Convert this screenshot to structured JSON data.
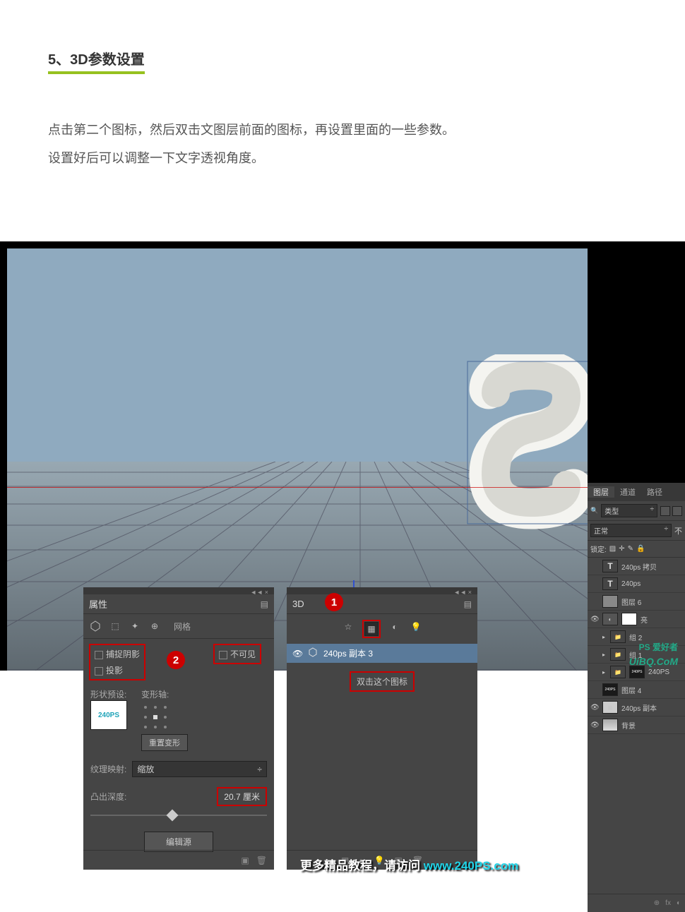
{
  "section": {
    "number": "5、",
    "title": "3D参数设置"
  },
  "body": {
    "line1": "点击第二个图标，然后双击文图层前面的图标，再设置里面的一些参数。",
    "line2": "设置好后可以调整一下文字透视角度。"
  },
  "properties_panel": {
    "title": "属性",
    "mesh_tab": "网格",
    "capture_shadow": "捕捉阴影",
    "cast_shadow": "投影",
    "invisible": "不可见",
    "shape_preset": "形状预设:",
    "preset_thumb_text": "240PS",
    "deform_axis": "变形轴:",
    "reset_deform": "重置变形",
    "texture_mapping": "纹理映射:",
    "texture_value": "缩放",
    "extrude_depth": "凸出深度:",
    "extrude_value": "20.7 厘米",
    "edit_source": "编辑源",
    "badge_2": "2"
  },
  "threed_panel": {
    "title": "3D",
    "badge_1": "1",
    "layer_name": "240ps 副本 3",
    "tip": "双击这个图标"
  },
  "layers_panel": {
    "tabs": {
      "layers": "图层",
      "channels": "通道",
      "paths": "路径"
    },
    "filter_label": "类型",
    "blend_mode": "正常",
    "opacity_label": "不",
    "lock_label": "锁定:",
    "rows": [
      {
        "type": "text",
        "name": "240ps 拷贝"
      },
      {
        "type": "text",
        "name": "240ps"
      },
      {
        "type": "solid",
        "name": "图层 6"
      },
      {
        "type": "mask",
        "name": "亮"
      },
      {
        "type": "group",
        "name": "组 2"
      },
      {
        "type": "group",
        "name": "组 1"
      },
      {
        "type": "logo",
        "name": "240PS"
      },
      {
        "type": "logo2",
        "name": "图层 4"
      },
      {
        "type": "3d",
        "name": "240ps 副本"
      },
      {
        "type": "bg",
        "name": "背景"
      }
    ],
    "fx_label": "fx"
  },
  "watermark": {
    "text": "更多精品教程，请访问 ",
    "url": "www.240PS.com"
  },
  "watermark2": "UiBQ.CoM",
  "watermark3": "PS 爱好者"
}
